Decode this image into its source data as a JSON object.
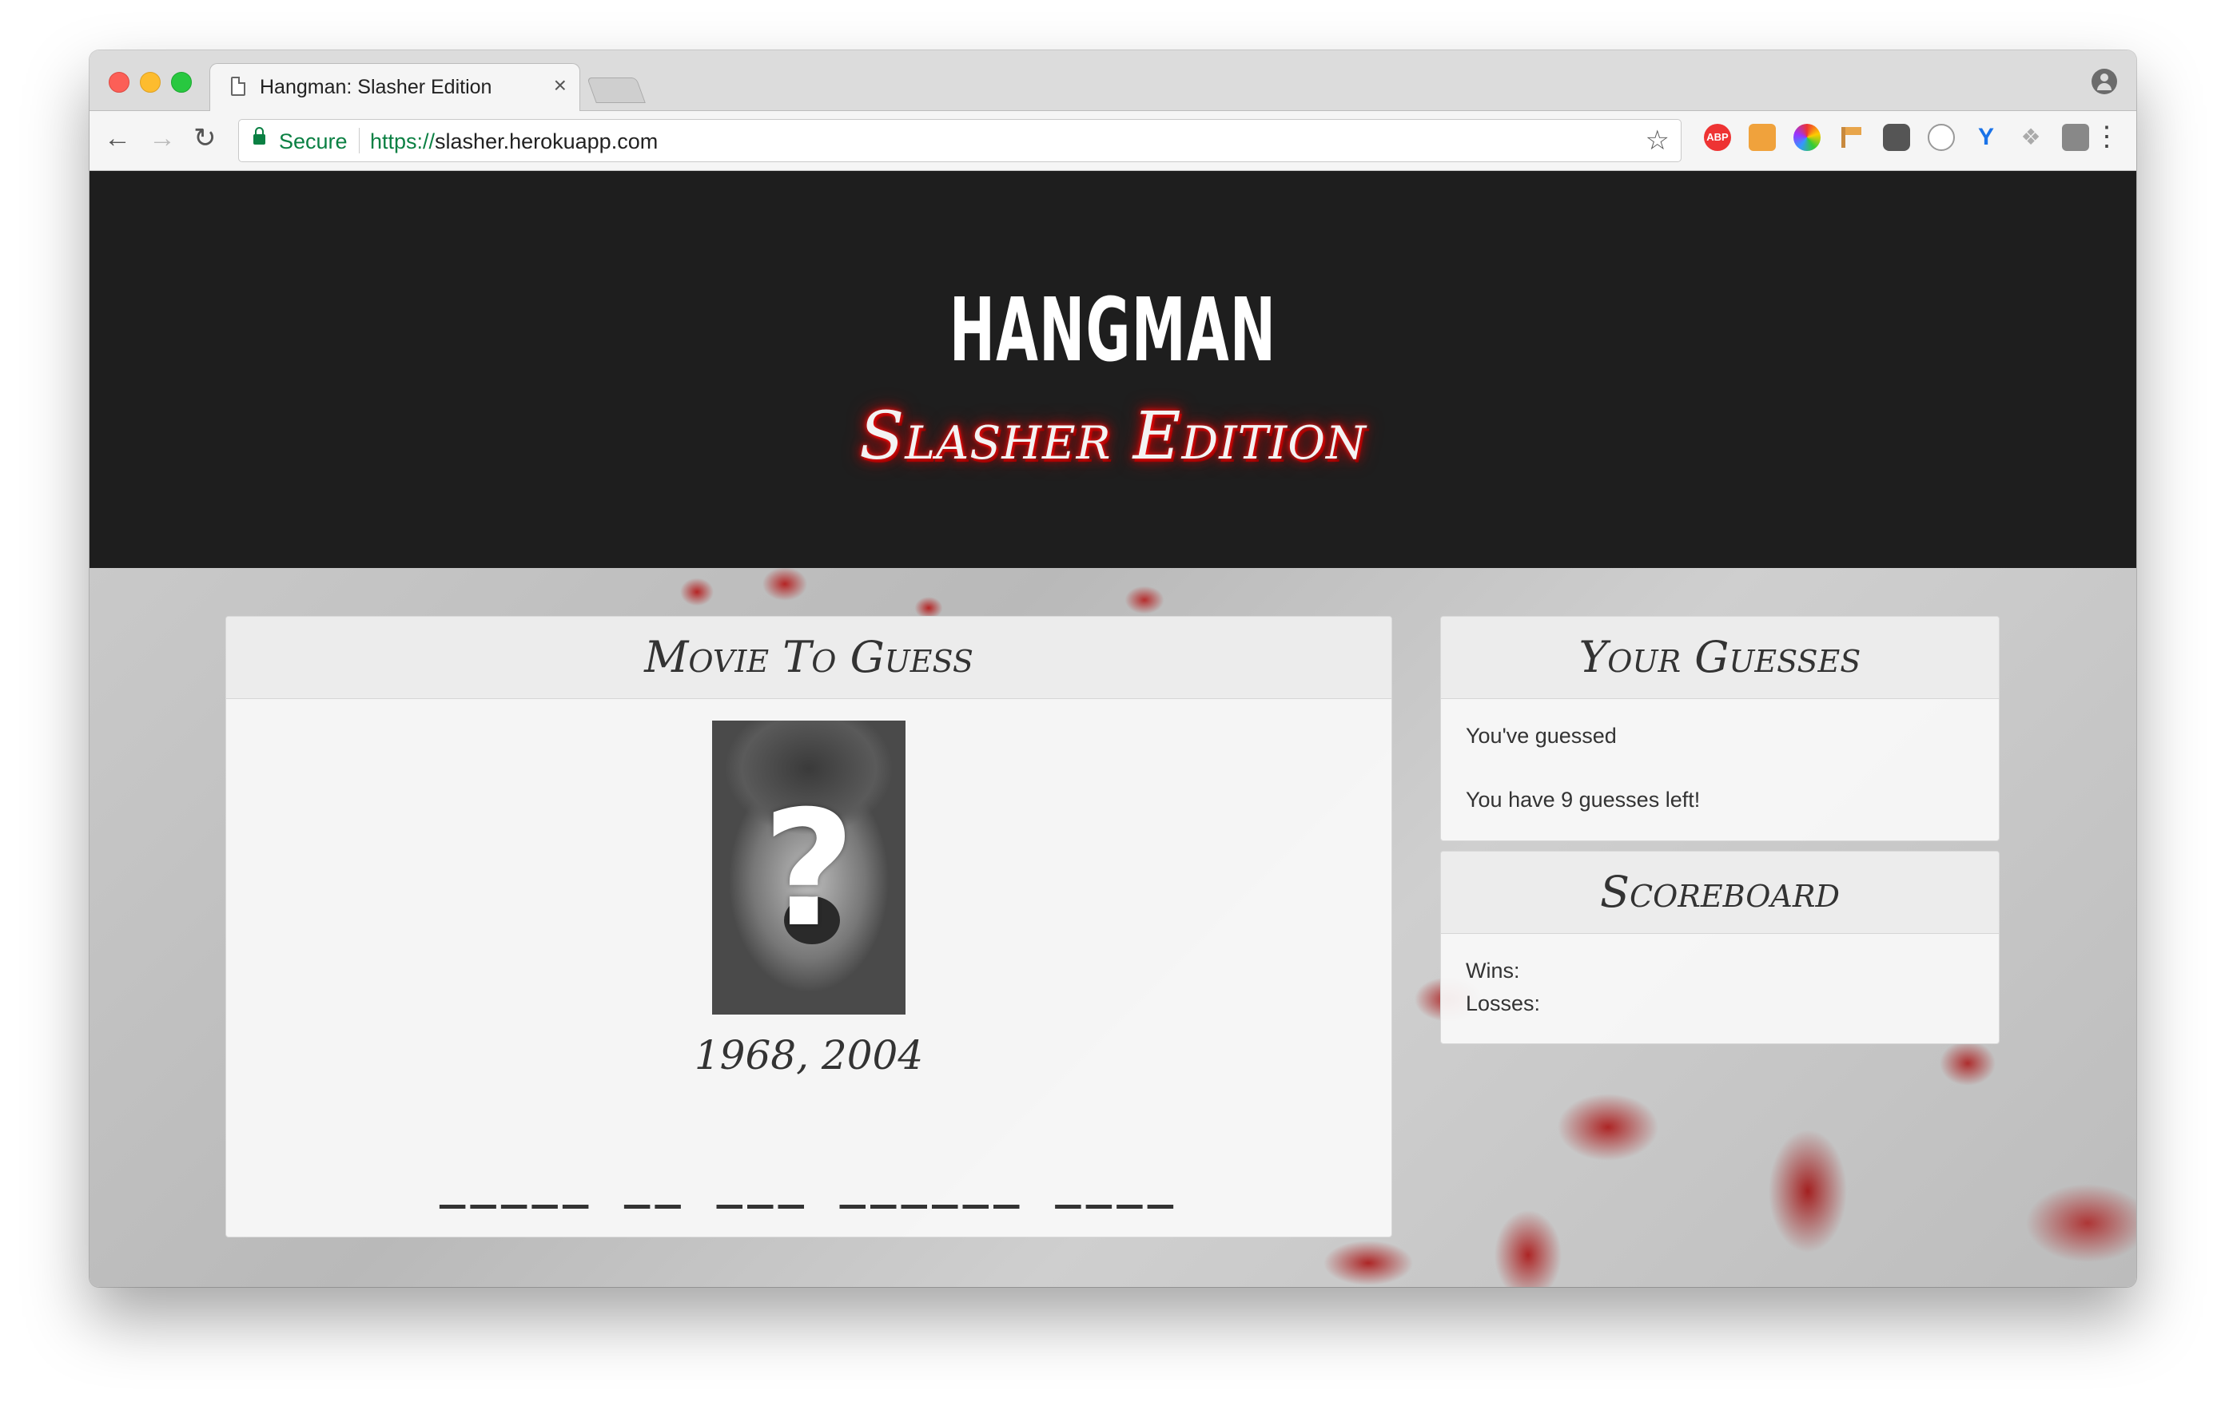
{
  "browser": {
    "tab_title": "Hangman: Slasher Edition",
    "tab_close": "×",
    "secure_label": "Secure",
    "url_scheme": "https://",
    "url_host": "slasher.herokuapp.com",
    "ext_abp": "ABP"
  },
  "site": {
    "title": "HANGMAN",
    "subtitle": "Slasher Edition"
  },
  "movie_panel": {
    "heading": "Movie To Guess",
    "years": "1968, 2004",
    "blanks": "_____ __ ___ ______ ____"
  },
  "guesses_panel": {
    "heading": "Your Guesses",
    "guessed_text": "You've guessed",
    "remaining_text": "You have 9 guesses left!"
  },
  "score_panel": {
    "heading": "Scoreboard",
    "wins_label": "Wins:",
    "losses_label": "Losses:"
  },
  "colors": {
    "header_bg": "#1e1e1e",
    "subtitle_glow": "#e00000",
    "secure_green": "#0b8043"
  }
}
